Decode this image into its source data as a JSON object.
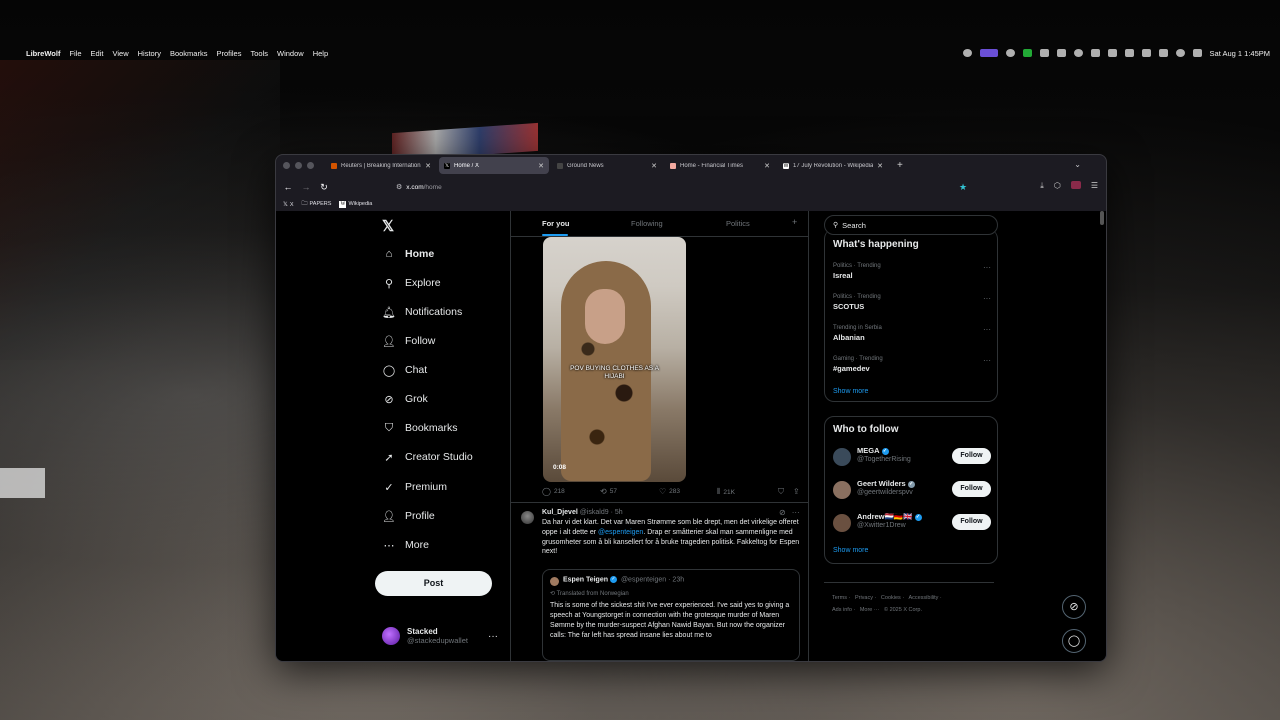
{
  "menubar": {
    "apple_glyph": "",
    "app_name": "LibreWolf",
    "menus": [
      "File",
      "Edit",
      "View",
      "History",
      "Bookmarks",
      "Profiles",
      "Tools",
      "Window",
      "Help"
    ],
    "clock": "Sat Aug 1  1:45PM"
  },
  "browser": {
    "tabs": [
      {
        "title": "Reuters | Breaking International",
        "favicon": "reuters-icon",
        "active": false
      },
      {
        "title": "Home / X",
        "favicon": "x-icon",
        "active": true
      },
      {
        "title": "Ground News",
        "favicon": "ground-news-icon",
        "active": false
      },
      {
        "title": "Home - Financial Times",
        "favicon": "ft-icon",
        "active": false
      },
      {
        "title": "17 July Revolution - Wikipedia",
        "favicon": "wikipedia-icon",
        "active": false
      }
    ],
    "new_tab_glyph": "+",
    "url_host": "x.com",
    "url_path": "/home",
    "bookmarks": [
      "X",
      "PAPERS",
      "Wikipedia"
    ]
  },
  "x": {
    "nav": [
      {
        "label": "Home",
        "icon": "home-icon",
        "glyph": "⌂",
        "active": true
      },
      {
        "label": "Explore",
        "icon": "search-icon",
        "glyph": "⚲",
        "active": false
      },
      {
        "label": "Notifications",
        "icon": "bell-icon",
        "glyph": "🔔︎",
        "active": false
      },
      {
        "label": "Follow",
        "icon": "add-person-icon",
        "glyph": "👤︎",
        "active": false
      },
      {
        "label": "Chat",
        "icon": "chat-icon",
        "glyph": "◯",
        "active": false
      },
      {
        "label": "Grok",
        "icon": "grok-icon",
        "glyph": "⊘",
        "active": false
      },
      {
        "label": "Bookmarks",
        "icon": "bookmark-icon",
        "glyph": "⛉",
        "active": false
      },
      {
        "label": "Creator Studio",
        "icon": "rocket-icon",
        "glyph": "➚",
        "active": false
      },
      {
        "label": "Premium",
        "icon": "verified-icon",
        "glyph": "✓",
        "active": false
      },
      {
        "label": "Profile",
        "icon": "person-icon",
        "glyph": "👤︎",
        "active": false
      },
      {
        "label": "More",
        "icon": "more-circle-icon",
        "glyph": "⋯",
        "active": false
      }
    ],
    "post_label": "Post",
    "account": {
      "name": "Stacked",
      "handle": "@stackedupwallet"
    },
    "timeline_tabs": [
      "For you",
      "Following",
      "Politics"
    ],
    "video": {
      "caption": "POV BUYING CLOTHES AS A HIJABI",
      "time": "0:08"
    },
    "tweet1_actions": {
      "replies": "218",
      "reposts": "57",
      "likes": "283",
      "views": "21K"
    },
    "tweet2": {
      "name": "Kul_Djevel",
      "handle": "@iskald9 · 5h",
      "text_before": "Da har vi det klart. Det var Maren Strømme som ble drept, men det virkelige offeret oppe i alt dette er ",
      "mention": "@espenteigen",
      "text_after": ". Drap er småtterier skal man sammenligne med grusomheter som å bli kansellert for å bruke tragedien politisk. Fakkeltog for Espen next!",
      "quote": {
        "name": "Espen Teigen",
        "handle": "@espenteigen · 23h",
        "translated": "Translated from Norwegian",
        "text": "This is some of the sickest shit I've ever experienced. I've said yes to giving a speech at Youngstorget in connection with the grotesque murder of Maren Sømme by the murder-suspect Afghan Nawid Bayan. But now the organizer calls: The far left has spread insane lies about me to"
      }
    },
    "search_placeholder": "Search",
    "happening": {
      "title": "What's happening",
      "trends": [
        {
          "context": "Politics · Trending",
          "topic": "Isreal"
        },
        {
          "context": "Politics · Trending",
          "topic": "SCOTUS"
        },
        {
          "context": "Trending in Serbia",
          "topic": "Albanian"
        },
        {
          "context": "Gaming · Trending",
          "topic": "#gamedev"
        }
      ],
      "show_more": "Show more"
    },
    "who_to_follow": {
      "title": "Who to follow",
      "users": [
        {
          "name": "MEGA",
          "handle": "@TogetherRising",
          "verified": "blue",
          "avatar_color": "#3a4a5a"
        },
        {
          "name": "Geert Wilders",
          "handle": "@geertwilderspvv",
          "verified": "gray",
          "avatar_color": "#8a7060"
        },
        {
          "name": "Andrew🇳🇱🇩🇪🇬🇧",
          "handle": "@Xwitter1Drew",
          "verified": "blue",
          "avatar_color": "#6a5040"
        }
      ],
      "follow_label": "Follow",
      "show_more": "Show more"
    },
    "footer": [
      "Terms",
      "Privacy",
      "Cookies",
      "Accessibility",
      "Ads info",
      "More ···",
      "© 2025 X Corp."
    ]
  },
  "colors": {
    "accent": "#1d9bf0",
    "background": "#000000",
    "border": "#2f3336",
    "muted": "#71767b"
  }
}
